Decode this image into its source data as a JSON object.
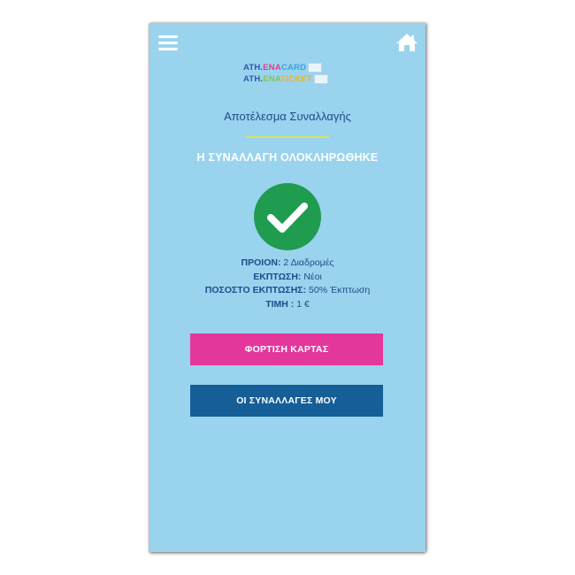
{
  "header": {
    "menu_icon": "hamburger-menu-icon",
    "home_icon": "home-icon"
  },
  "logo": {
    "line1_prefix": "ATH.",
    "line1_ena": "ENA",
    "line1_suffix": "CARD",
    "line2_prefix": "ATH.",
    "line2_ena": "ENA",
    "line2_suffix": "TICKET"
  },
  "page": {
    "title": "Αποτέλεσμα Συναλλαγής",
    "status": "Η ΣΥΝΑΛΛΑΓΗ ΟΛΟΚΛΗΡΩΘΗΚΕ"
  },
  "result_icon": "check-circle-icon",
  "colors": {
    "background": "#9ad3ee",
    "success_green": "#1f9c4f",
    "pink": "#e4379b",
    "blue": "#155e98",
    "divider": "#d9e35a"
  },
  "details": {
    "product_label": "ΠΡΟΙΟΝ:",
    "product_value": "2 Διαδρομές",
    "discount_label": "ΕΚΠΤΩΣΗ:",
    "discount_value": "Νέοι",
    "percent_label": "ΠΟΣΟΣΤΟ ΕΚΠΤΩΣΗΣ:",
    "percent_value": "50% Έκπτωση",
    "price_label": "ΤΙΜΗ :",
    "price_value": "1 €"
  },
  "buttons": {
    "load_card": "ΦΟΡΤΙΣΗ ΚΑΡΤΑΣ",
    "my_transactions": "ΟΙ ΣΥΝΑΛΛΑΓΕΣ ΜΟΥ"
  }
}
